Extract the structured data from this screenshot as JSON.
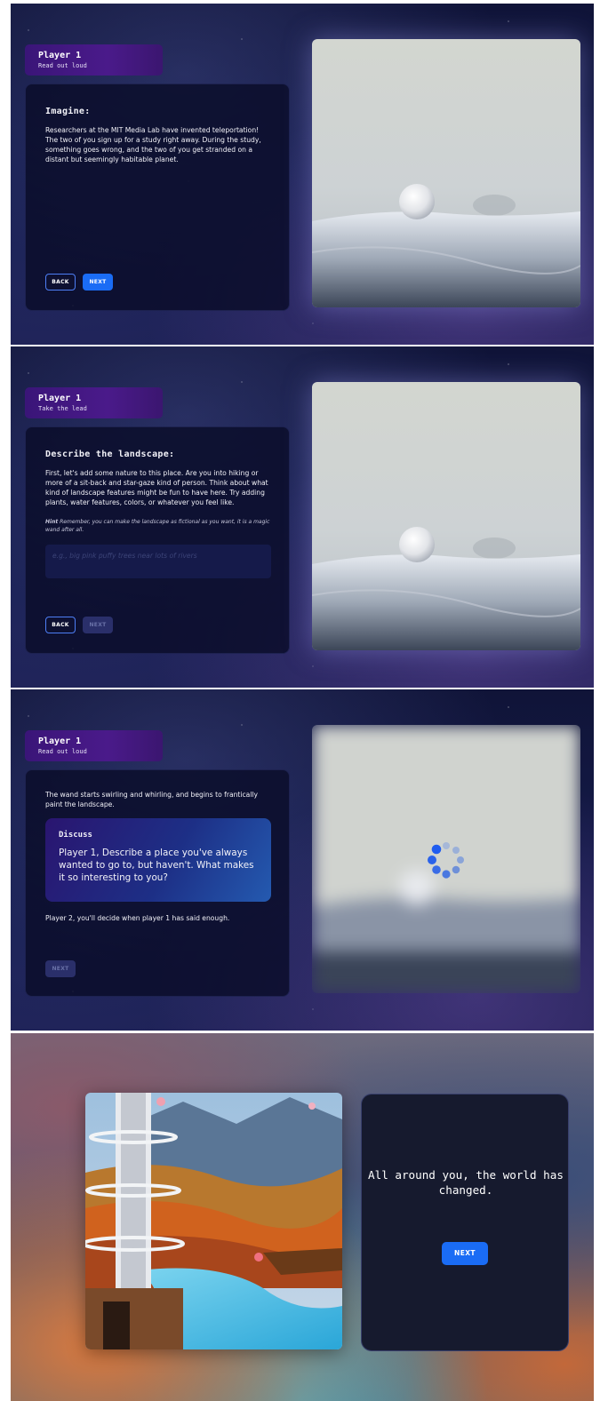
{
  "screen1": {
    "player": {
      "name": "Player 1",
      "subtitle": "Read out loud"
    },
    "heading": "Imagine:",
    "body": "Researchers at the MIT Media Lab have invented teleportation! The two of you sign up for a study right away. During the study, something goes wrong, and the two of you get stranded on a distant but seemingly habitable planet.",
    "back_label": "BACK",
    "next_label": "NEXT"
  },
  "screen2": {
    "player": {
      "name": "Player 1",
      "subtitle": "Take the lead"
    },
    "heading": "Describe the landscape:",
    "body": "First, let's add some nature to this place. Are you into hiking or more of a sit-back and star-gaze kind of person. Think about what kind of landscape features might be fun to have here. Try adding plants, water features, colors, or whatever you feel like.",
    "hint_label": "Hint",
    "hint_text": "Remember, you can make the landscape as fictional as you want, it is a magic wand after all.",
    "input_placeholder": "e.g., big pink puffy trees near lots of rivers",
    "input_value": "",
    "back_label": "BACK",
    "next_label": "NEXT"
  },
  "screen3": {
    "player": {
      "name": "Player 1",
      "subtitle": "Read out loud"
    },
    "body": "The wand starts swirling and whirling, and begins to frantically paint the landscape.",
    "discuss_title": "Discuss",
    "discuss_text": "Player 1, Describe a place you've always wanted to go to, but haven't. What makes it so interesting to you?",
    "footer": "Player 2, you'll decide when player 1 has said enough.",
    "next_label": "NEXT"
  },
  "screen4": {
    "message": "All around you, the world has changed.",
    "next_label": "NEXT"
  },
  "colors": {
    "accent": "#1a6cf5",
    "player_tag": "#4a1a8a",
    "card_bg": "#0a0c28",
    "disabled_button": "#2a2f6a"
  }
}
